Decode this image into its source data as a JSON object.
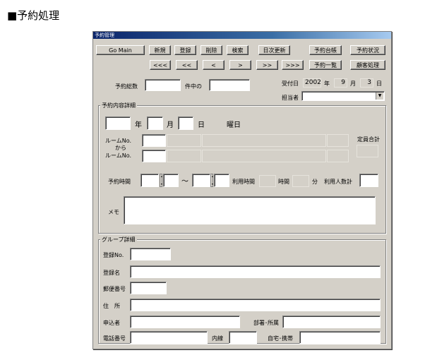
{
  "page_heading": "■予約処理",
  "window": {
    "title": "予約管理",
    "toolbar": {
      "go_main": "Go Main",
      "new": "新規",
      "register": "登録",
      "delete": "削除",
      "search": "検索",
      "daily_update": "日次更新",
      "reservation_ledger": "予約台帳",
      "reservation_status": "予約状況",
      "first": "<<<",
      "prev_page": "<<",
      "prev": "<",
      "next": ">",
      "next_page": ">>",
      "last": ">>>",
      "reservation_list": "予約一覧",
      "customer_processing": "顧客処理"
    },
    "summary": {
      "total_label": "予約総数",
      "total_value": "",
      "of_label": "件中の",
      "index_value": "",
      "received_label": "受付日",
      "received_year": "2002",
      "year_label": "年",
      "received_month": "9",
      "month_label": "月",
      "received_day": "3",
      "day_label": "日",
      "staff_label": "担当者",
      "staff_value": ""
    },
    "details": {
      "group_title": "予約内容詳細",
      "date_year": "",
      "year_label": "年",
      "date_month": "",
      "month_label": "月",
      "date_day": "",
      "day_label": "日",
      "weekday_label": "曜日",
      "room_no_label": "ルームNo.",
      "from_label": "から",
      "room_no_label2": "ルームNo.",
      "capacity_label": "定員合計",
      "time_label": "予約時間",
      "tilde": "〜",
      "use_time_label": "利用時間",
      "hours_label": "時間",
      "minutes_label": "分",
      "people_label": "利用人数計",
      "memo_label": "メモ",
      "memo_value": ""
    },
    "group": {
      "group_title": "グループ詳細",
      "reg_no_label": "登録No.",
      "reg_name_label": "登録名",
      "postal_label": "郵便番号",
      "address_label": "住　所",
      "applicant_label": "申込者",
      "dept_label": "部署･所属",
      "phone_label": "電話番号",
      "extension_label": "内線",
      "home_mobile_label": "自宅･携帯"
    }
  }
}
